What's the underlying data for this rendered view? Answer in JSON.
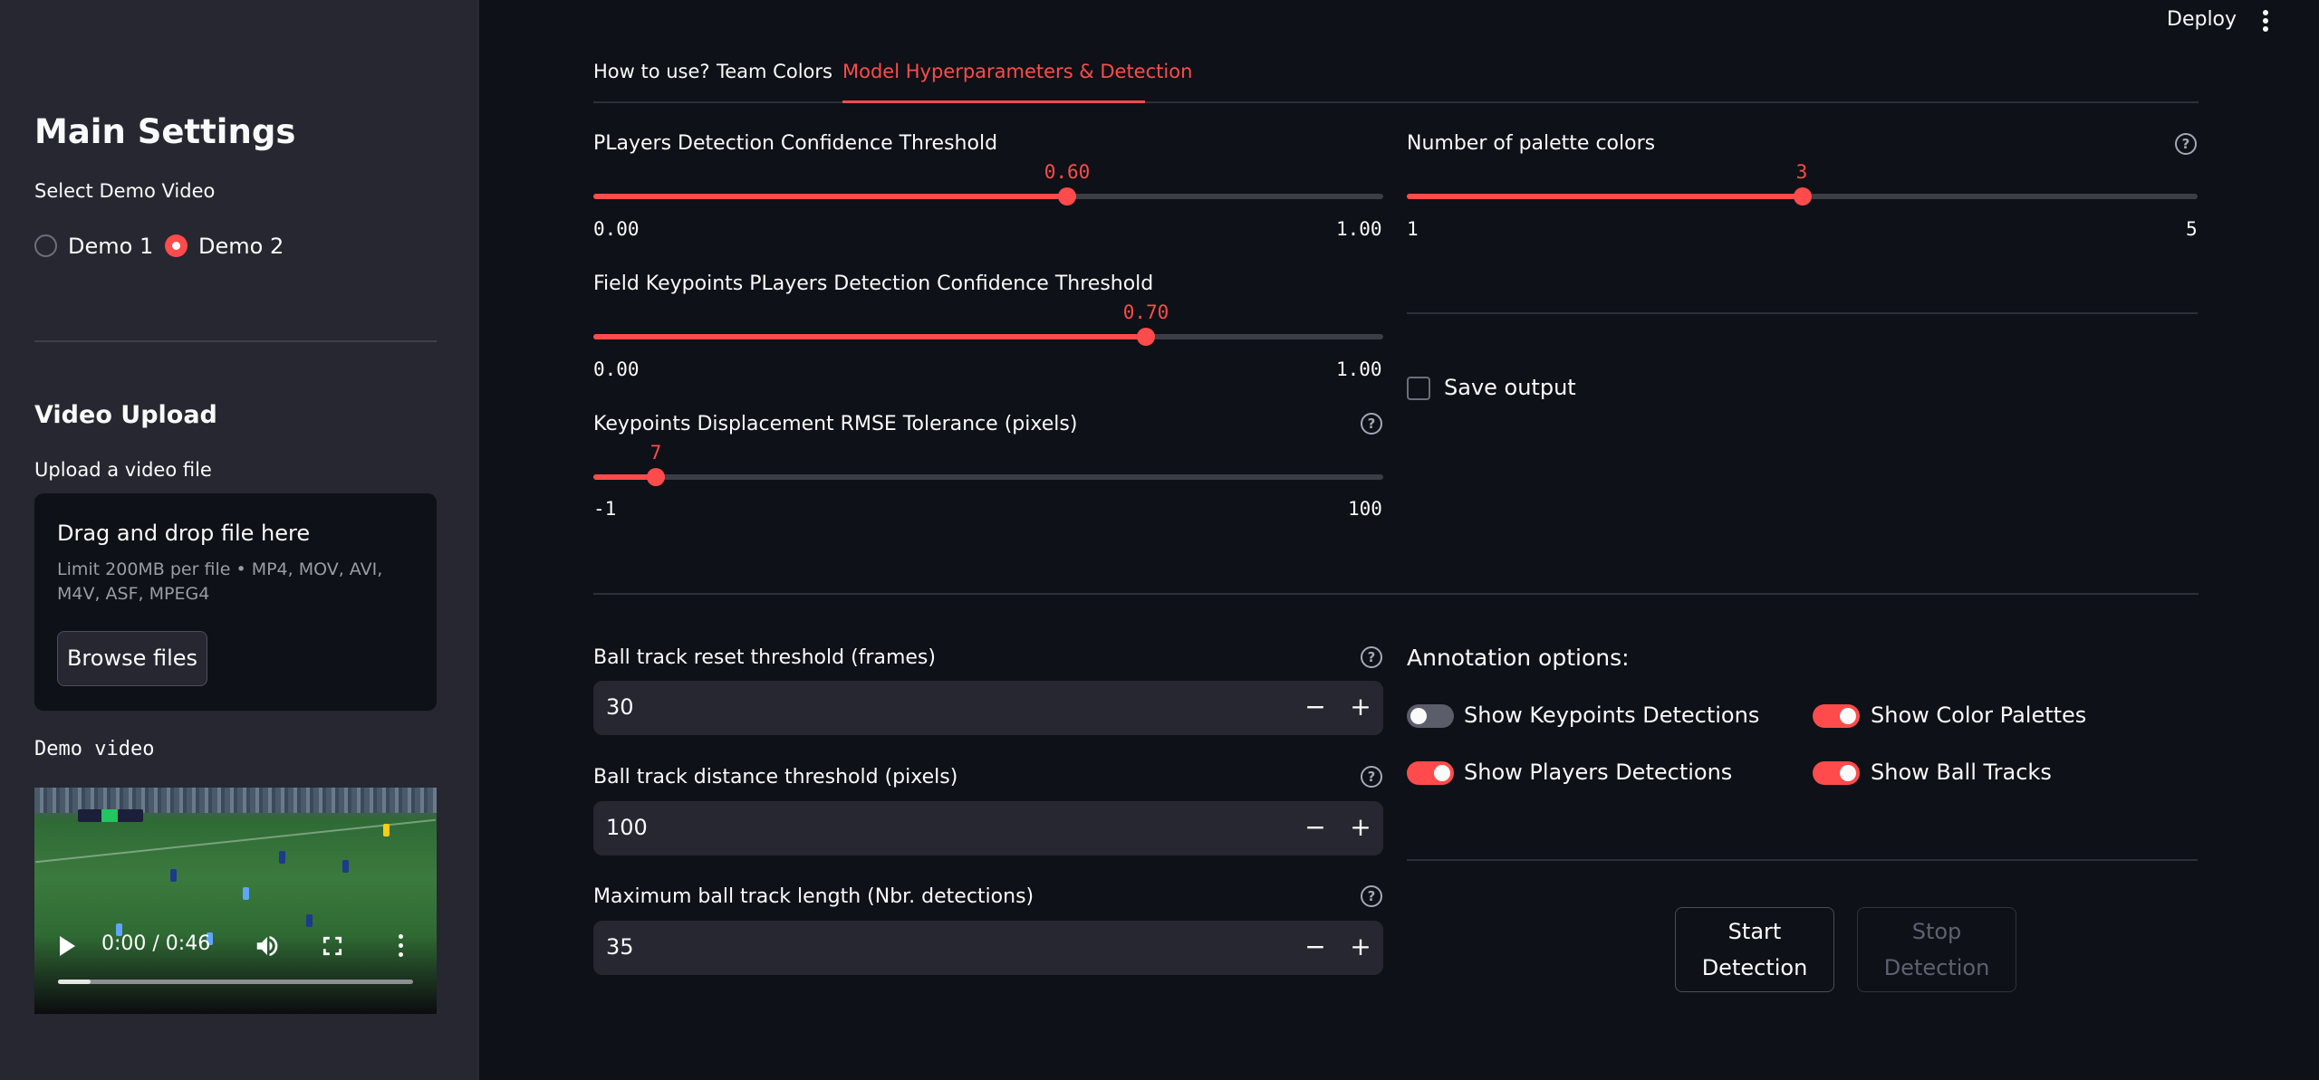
{
  "header": {
    "deploy_label": "Deploy",
    "menu_icon": "kebab-menu-icon"
  },
  "sidebar": {
    "title": "Main Settings",
    "demo_label": "Select Demo Video",
    "demo_options": [
      "Demo 1",
      "Demo 2"
    ],
    "demo_selected": "Demo 2",
    "upload_title": "Video Upload",
    "upload_label": "Upload a video file",
    "dropzone_title": "Drag and drop file here",
    "dropzone_limit": "Limit 200MB per file • MP4, MOV, AVI, M4V, ASF, MPEG4",
    "browse_label": "Browse files",
    "demo_video_label": "Demo video",
    "video_time": "0:00 / 0:46"
  },
  "tabs": [
    {
      "label": "How to use?"
    },
    {
      "label": "Team Colors"
    },
    {
      "label": "Model Hyperparameters & Detection",
      "active": true
    }
  ],
  "sliders": {
    "players_conf": {
      "label": "PLayers Detection Confidence Threshold",
      "value": "0.60",
      "min": "0.00",
      "max": "1.00",
      "fraction": 0.6
    },
    "palette": {
      "label": "Number of palette colors",
      "value": "3",
      "min": "1",
      "max": "5",
      "fraction": 0.5
    },
    "keypoints_conf": {
      "label": "Field Keypoints PLayers Detection Confidence Threshold",
      "value": "0.70",
      "min": "0.00",
      "max": "1.00",
      "fraction": 0.7
    },
    "rmse": {
      "label": "Keypoints Displacement RMSE Tolerance (pixels)",
      "value": "7",
      "min": "-1",
      "max": "100",
      "fraction": 0.0792
    }
  },
  "save_output": {
    "label": "Save output",
    "checked": false
  },
  "number_inputs": {
    "reset": {
      "label": "Ball track reset threshold (frames)",
      "value": "30"
    },
    "distance": {
      "label": "Ball track distance threshold (pixels)",
      "value": "100"
    },
    "maxlen": {
      "label": "Maximum ball track length (Nbr. detections)",
      "value": "35"
    }
  },
  "annotation": {
    "title": "Annotation options:",
    "toggles": [
      {
        "label": "Show Keypoints Detections",
        "on": false
      },
      {
        "label": "Show Color Palettes",
        "on": true
      },
      {
        "label": "Show Players Detections",
        "on": true
      },
      {
        "label": "Show Ball Tracks",
        "on": true
      }
    ]
  },
  "buttons": {
    "start_line1": "Start",
    "start_line2": "Detection",
    "stop_line1": "Stop",
    "stop_line2": "Detection"
  },
  "colors": {
    "accent": "#ff4b4b",
    "bg": "#0e1117",
    "sidebar": "#262730"
  }
}
